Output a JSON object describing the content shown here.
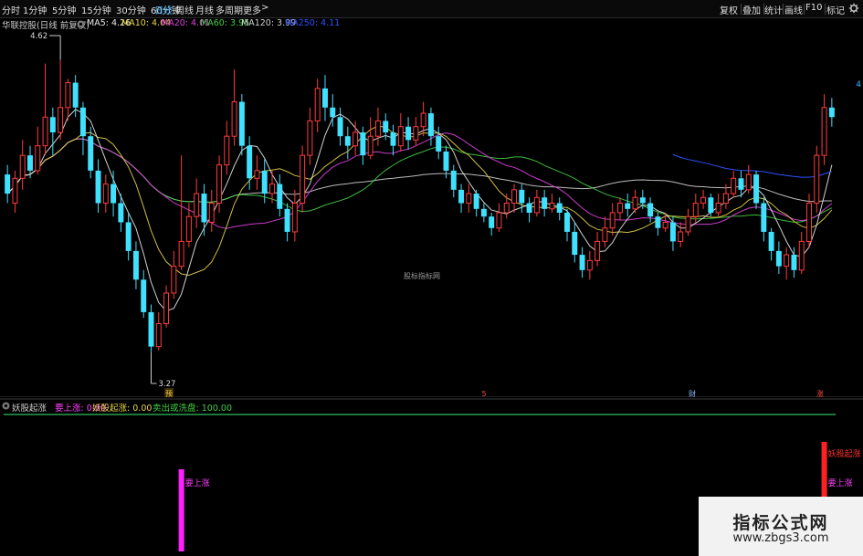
{
  "toolbar": {
    "periods": [
      "分时",
      "1分钟",
      "5分钟",
      "15分钟",
      "30分钟",
      "60分钟",
      "日线",
      "周线",
      "月线",
      "多周期",
      "更多"
    ],
    "active_period": "日线",
    "more_arrow": ">",
    "tools": [
      "复权",
      "叠加",
      "统计",
      "画线",
      "F10",
      "标记"
    ],
    "settings_icon": "gear-icon",
    "window_control_icon": "grid-icon"
  },
  "legend": {
    "stock": "华联控股(日线 前复权)",
    "ma5": "MA5: 4.26",
    "ma10": "MA10: 4.04",
    "ma20": "MA20: 4.01",
    "ma60": "MA60: 3.95",
    "ma120": "MA120: 3.99",
    "ma250": "MA250: 4.11"
  },
  "colors": {
    "up": "#ff3c3c",
    "down": "#40e0ff",
    "ma5": "#e8e8e8",
    "ma10": "#e8d34a",
    "ma20": "#e040e0",
    "ma60": "#40d040",
    "ma120": "#d0d0d0",
    "ma250": "#3050ff",
    "ind_line": "#30c060",
    "signal1": "#ff20ff",
    "signal2": "#ff2020",
    "signal_text1": "#ff40ff",
    "signal_text2": "#ff3030"
  },
  "chart_data": {
    "type": "candlestick",
    "title": "华联控股(日线 前复权)",
    "ylim": [
      3.05,
      4.95
    ],
    "high_label": "4.62",
    "low_label": "3.27",
    "right_price": "4",
    "watermark_center": "股标指标网",
    "event_markers": [
      "预",
      "5",
      "财",
      "涨"
    ],
    "candles": [
      [
        4.2,
        4.1,
        4.25,
        4.05
      ],
      [
        4.05,
        4.18,
        4.22,
        4.0
      ],
      [
        4.18,
        4.3,
        4.38,
        4.12
      ],
      [
        4.3,
        4.22,
        4.35,
        4.18
      ],
      [
        4.22,
        4.35,
        4.45,
        4.2
      ],
      [
        4.35,
        4.5,
        4.78,
        4.3
      ],
      [
        4.5,
        4.42,
        4.55,
        4.3
      ],
      [
        4.42,
        4.55,
        4.8,
        4.38
      ],
      [
        4.55,
        4.68,
        4.7,
        4.48
      ],
      [
        4.68,
        4.55,
        4.72,
        4.5
      ],
      [
        4.55,
        4.4,
        4.58,
        4.3
      ],
      [
        4.4,
        4.22,
        4.45,
        4.18
      ],
      [
        4.22,
        4.05,
        4.28,
        4.0
      ],
      [
        4.05,
        4.15,
        4.2,
        4.0
      ],
      [
        4.15,
        4.05,
        4.22,
        3.98
      ],
      [
        4.05,
        3.95,
        4.1,
        3.9
      ],
      [
        3.95,
        3.8,
        4.0,
        3.75
      ],
      [
        3.8,
        3.65,
        3.85,
        3.6
      ],
      [
        3.65,
        3.48,
        3.7,
        3.45
      ],
      [
        3.48,
        3.3,
        3.52,
        3.27
      ],
      [
        3.3,
        3.42,
        3.48,
        3.28
      ],
      [
        3.42,
        3.58,
        3.62,
        3.4
      ],
      [
        3.58,
        3.72,
        3.8,
        3.55
      ],
      [
        3.72,
        3.85,
        4.3,
        3.7
      ],
      [
        3.85,
        3.98,
        4.05,
        3.82
      ],
      [
        3.98,
        4.1,
        4.18,
        3.92
      ],
      [
        4.1,
        3.95,
        4.15,
        3.88
      ],
      [
        3.95,
        4.05,
        4.12,
        3.9
      ],
      [
        4.05,
        4.25,
        4.3,
        4.0
      ],
      [
        4.25,
        4.4,
        4.48,
        4.2
      ],
      [
        4.4,
        4.58,
        4.75,
        4.35
      ],
      [
        4.58,
        4.35,
        4.62,
        4.3
      ],
      [
        4.35,
        4.18,
        4.4,
        4.12
      ],
      [
        4.18,
        4.22,
        4.3,
        4.12
      ],
      [
        4.22,
        4.1,
        4.28,
        4.05
      ],
      [
        4.1,
        4.15,
        4.22,
        4.05
      ],
      [
        4.15,
        4.02,
        4.2,
        3.98
      ],
      [
        4.02,
        3.9,
        4.05,
        3.85
      ],
      [
        3.9,
        4.05,
        4.12,
        3.85
      ],
      [
        4.05,
        4.3,
        4.35,
        4.0
      ],
      [
        4.3,
        4.48,
        4.55,
        4.25
      ],
      [
        4.48,
        4.65,
        4.7,
        4.42
      ],
      [
        4.65,
        4.55,
        4.72,
        4.48
      ],
      [
        4.55,
        4.5,
        4.62,
        4.45
      ],
      [
        4.5,
        4.4,
        4.55,
        4.35
      ],
      [
        4.4,
        4.35,
        4.45,
        4.28
      ],
      [
        4.35,
        4.42,
        4.48,
        4.3
      ],
      [
        4.42,
        4.3,
        4.45,
        4.25
      ],
      [
        4.3,
        4.4,
        4.5,
        4.28
      ],
      [
        4.4,
        4.48,
        4.55,
        4.35
      ],
      [
        4.48,
        4.42,
        4.52,
        4.38
      ],
      [
        4.42,
        4.35,
        4.46,
        4.3
      ],
      [
        4.35,
        4.45,
        4.52,
        4.32
      ],
      [
        4.45,
        4.38,
        4.5,
        4.33
      ],
      [
        4.38,
        4.45,
        4.5,
        4.35
      ],
      [
        4.45,
        4.52,
        4.58,
        4.4
      ],
      [
        4.52,
        4.4,
        4.55,
        4.35
      ],
      [
        4.4,
        4.32,
        4.45,
        4.28
      ],
      [
        4.32,
        4.22,
        4.35,
        4.18
      ],
      [
        4.22,
        4.12,
        4.25,
        4.08
      ],
      [
        4.12,
        4.05,
        4.15,
        4.0
      ],
      [
        4.05,
        4.1,
        4.15,
        4.0
      ],
      [
        4.1,
        4.02,
        4.12,
        3.98
      ],
      [
        4.02,
        3.98,
        4.05,
        3.95
      ],
      [
        3.98,
        3.92,
        4.0,
        3.88
      ],
      [
        3.92,
        4.0,
        4.05,
        3.9
      ],
      [
        4.0,
        4.05,
        4.1,
        3.97
      ],
      [
        4.05,
        4.12,
        4.15,
        4.0
      ],
      [
        4.12,
        4.05,
        4.15,
        4.0
      ],
      [
        4.05,
        4.0,
        4.08,
        3.95
      ],
      [
        4.0,
        4.08,
        4.12,
        3.98
      ],
      [
        4.08,
        4.02,
        4.12,
        3.98
      ],
      [
        4.02,
        4.05,
        4.1,
        4.0
      ],
      [
        4.05,
        4.0,
        4.08,
        3.96
      ],
      [
        4.0,
        3.9,
        4.02,
        3.85
      ],
      [
        3.9,
        3.78,
        3.95,
        3.74
      ],
      [
        3.78,
        3.7,
        3.82,
        3.66
      ],
      [
        3.7,
        3.75,
        3.8,
        3.65
      ],
      [
        3.75,
        3.85,
        3.9,
        3.72
      ],
      [
        3.85,
        3.92,
        3.98,
        3.82
      ],
      [
        3.92,
        4.0,
        4.05,
        3.88
      ],
      [
        4.0,
        4.05,
        4.08,
        3.96
      ],
      [
        4.05,
        4.02,
        4.1,
        3.98
      ],
      [
        4.02,
        4.08,
        4.12,
        4.0
      ],
      [
        4.08,
        4.05,
        4.12,
        4.02
      ],
      [
        4.05,
        3.98,
        4.08,
        3.95
      ],
      [
        3.98,
        3.92,
        4.0,
        3.88
      ],
      [
        3.92,
        3.95,
        4.0,
        3.9
      ],
      [
        3.95,
        3.85,
        3.98,
        3.8
      ],
      [
        3.85,
        3.9,
        3.95,
        3.82
      ],
      [
        3.9,
        3.98,
        4.02,
        3.88
      ],
      [
        3.98,
        4.05,
        4.1,
        3.95
      ],
      [
        4.05,
        4.08,
        4.12,
        4.02
      ],
      [
        4.08,
        4.0,
        4.1,
        3.98
      ],
      [
        4.0,
        4.05,
        4.1,
        3.98
      ],
      [
        4.05,
        4.1,
        4.15,
        4.02
      ],
      [
        4.1,
        4.18,
        4.22,
        4.08
      ],
      [
        4.18,
        4.12,
        4.22,
        4.08
      ],
      [
        4.12,
        4.2,
        4.25,
        4.1
      ],
      [
        4.2,
        4.05,
        4.22,
        4.02
      ],
      [
        4.05,
        3.9,
        4.08,
        3.85
      ],
      [
        3.9,
        3.8,
        3.92,
        3.75
      ],
      [
        3.8,
        3.72,
        3.85,
        3.68
      ],
      [
        3.72,
        3.78,
        3.82,
        3.65
      ],
      [
        3.78,
        3.7,
        3.82,
        3.66
      ],
      [
        3.7,
        3.85,
        3.9,
        3.68
      ],
      [
        3.85,
        4.05,
        4.1,
        3.82
      ],
      [
        4.05,
        4.3,
        4.35,
        4.0
      ],
      [
        4.3,
        4.55,
        4.62,
        4.25
      ],
      [
        4.55,
        4.5,
        4.6,
        4.45
      ]
    ],
    "indicator": {
      "name": "妖股起涨",
      "series": [
        {
          "name": "要上涨",
          "value": "0.00"
        },
        {
          "name": "妖股起涨",
          "value": "0.00"
        },
        {
          "name": "卖出或洗盘",
          "value": "100.00"
        }
      ],
      "signals": [
        {
          "index": 23,
          "labels": [
            "要上涨"
          ]
        },
        {
          "index": 108,
          "labels": [
            "妖股起涨",
            "要上涨"
          ]
        }
      ]
    }
  },
  "watermark": {
    "title": "指标公式网",
    "url": "www.zbgs3.com"
  }
}
